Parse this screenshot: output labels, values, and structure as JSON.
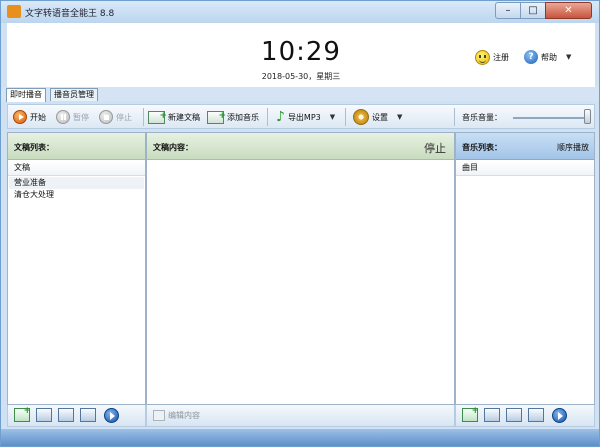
{
  "window": {
    "title": "文字转语音全能王 8.8"
  },
  "header": {
    "time": "10:29",
    "date": "2018-05-30，星期三",
    "register_label": "注册",
    "help_label": "帮助"
  },
  "tabs": [
    {
      "label": "即时播音"
    },
    {
      "label": "播音员管理"
    }
  ],
  "toolbar": {
    "start_label": "开始",
    "pause_label": "暂停",
    "stop_label": "停止",
    "new_doc_label": "新建文稿",
    "add_music_label": "添加音乐",
    "export_label": "导出MP3",
    "settings_label": "设置",
    "volume_label": "音乐音量：",
    "volume_level": 1.0
  },
  "doc_list": {
    "title": "文稿列表：",
    "column_header": "文稿",
    "items": [
      "营业准备",
      "清仓大处理"
    ]
  },
  "doc_content": {
    "title": "文稿内容：",
    "status": "停止"
  },
  "music_list": {
    "title": "音乐列表：",
    "mode": "顺序播放",
    "column_header": "曲目"
  },
  "bottom": {
    "edit_label": "编辑内容"
  },
  "colors": {
    "title_bar": "#bcd6ef",
    "accent_blue": "#1a5fb8",
    "start_orange": "#d85a08",
    "doc_header_green": "#c8dcbf",
    "music_header_blue": "#a3c4e8"
  }
}
